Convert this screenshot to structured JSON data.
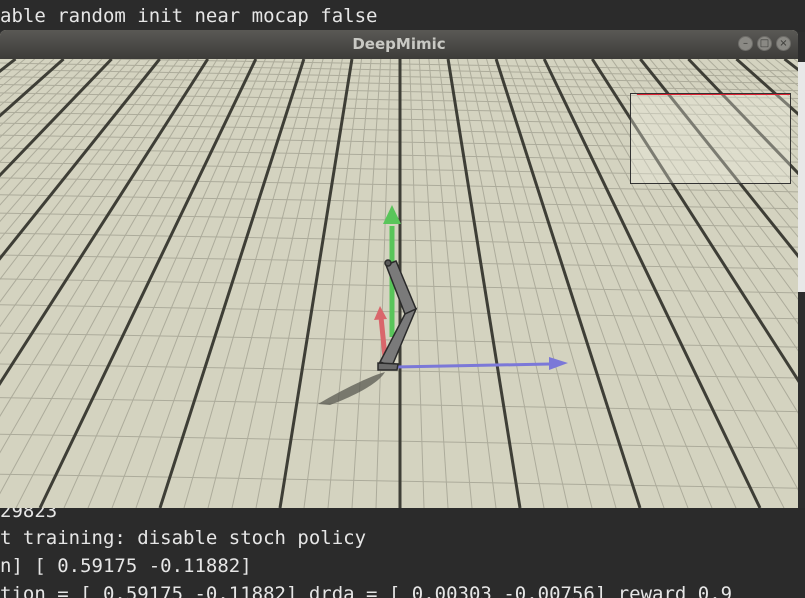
{
  "terminal": {
    "top_line": "able random init near mocap false",
    "bottom_lines": [
      "29823",
      "t training: disable stoch policy",
      "n] [ 0.59175 -0.11882]",
      "tion = [ 0.59175 -0.11882] drda = [ 0.00303 -0.00756] reward 0.9"
    ]
  },
  "window": {
    "title": "DeepMimic",
    "buttons": {
      "minimize": "–",
      "maximize": "□",
      "close": "×"
    }
  },
  "scene": {
    "colors": {
      "ground": "#d4d3c0",
      "grid_line": "#3e3e36",
      "axis_x": "#7b78d8",
      "axis_y": "#59c55a",
      "axis_z": "#d9666b",
      "character": "#7a7a7a"
    }
  }
}
